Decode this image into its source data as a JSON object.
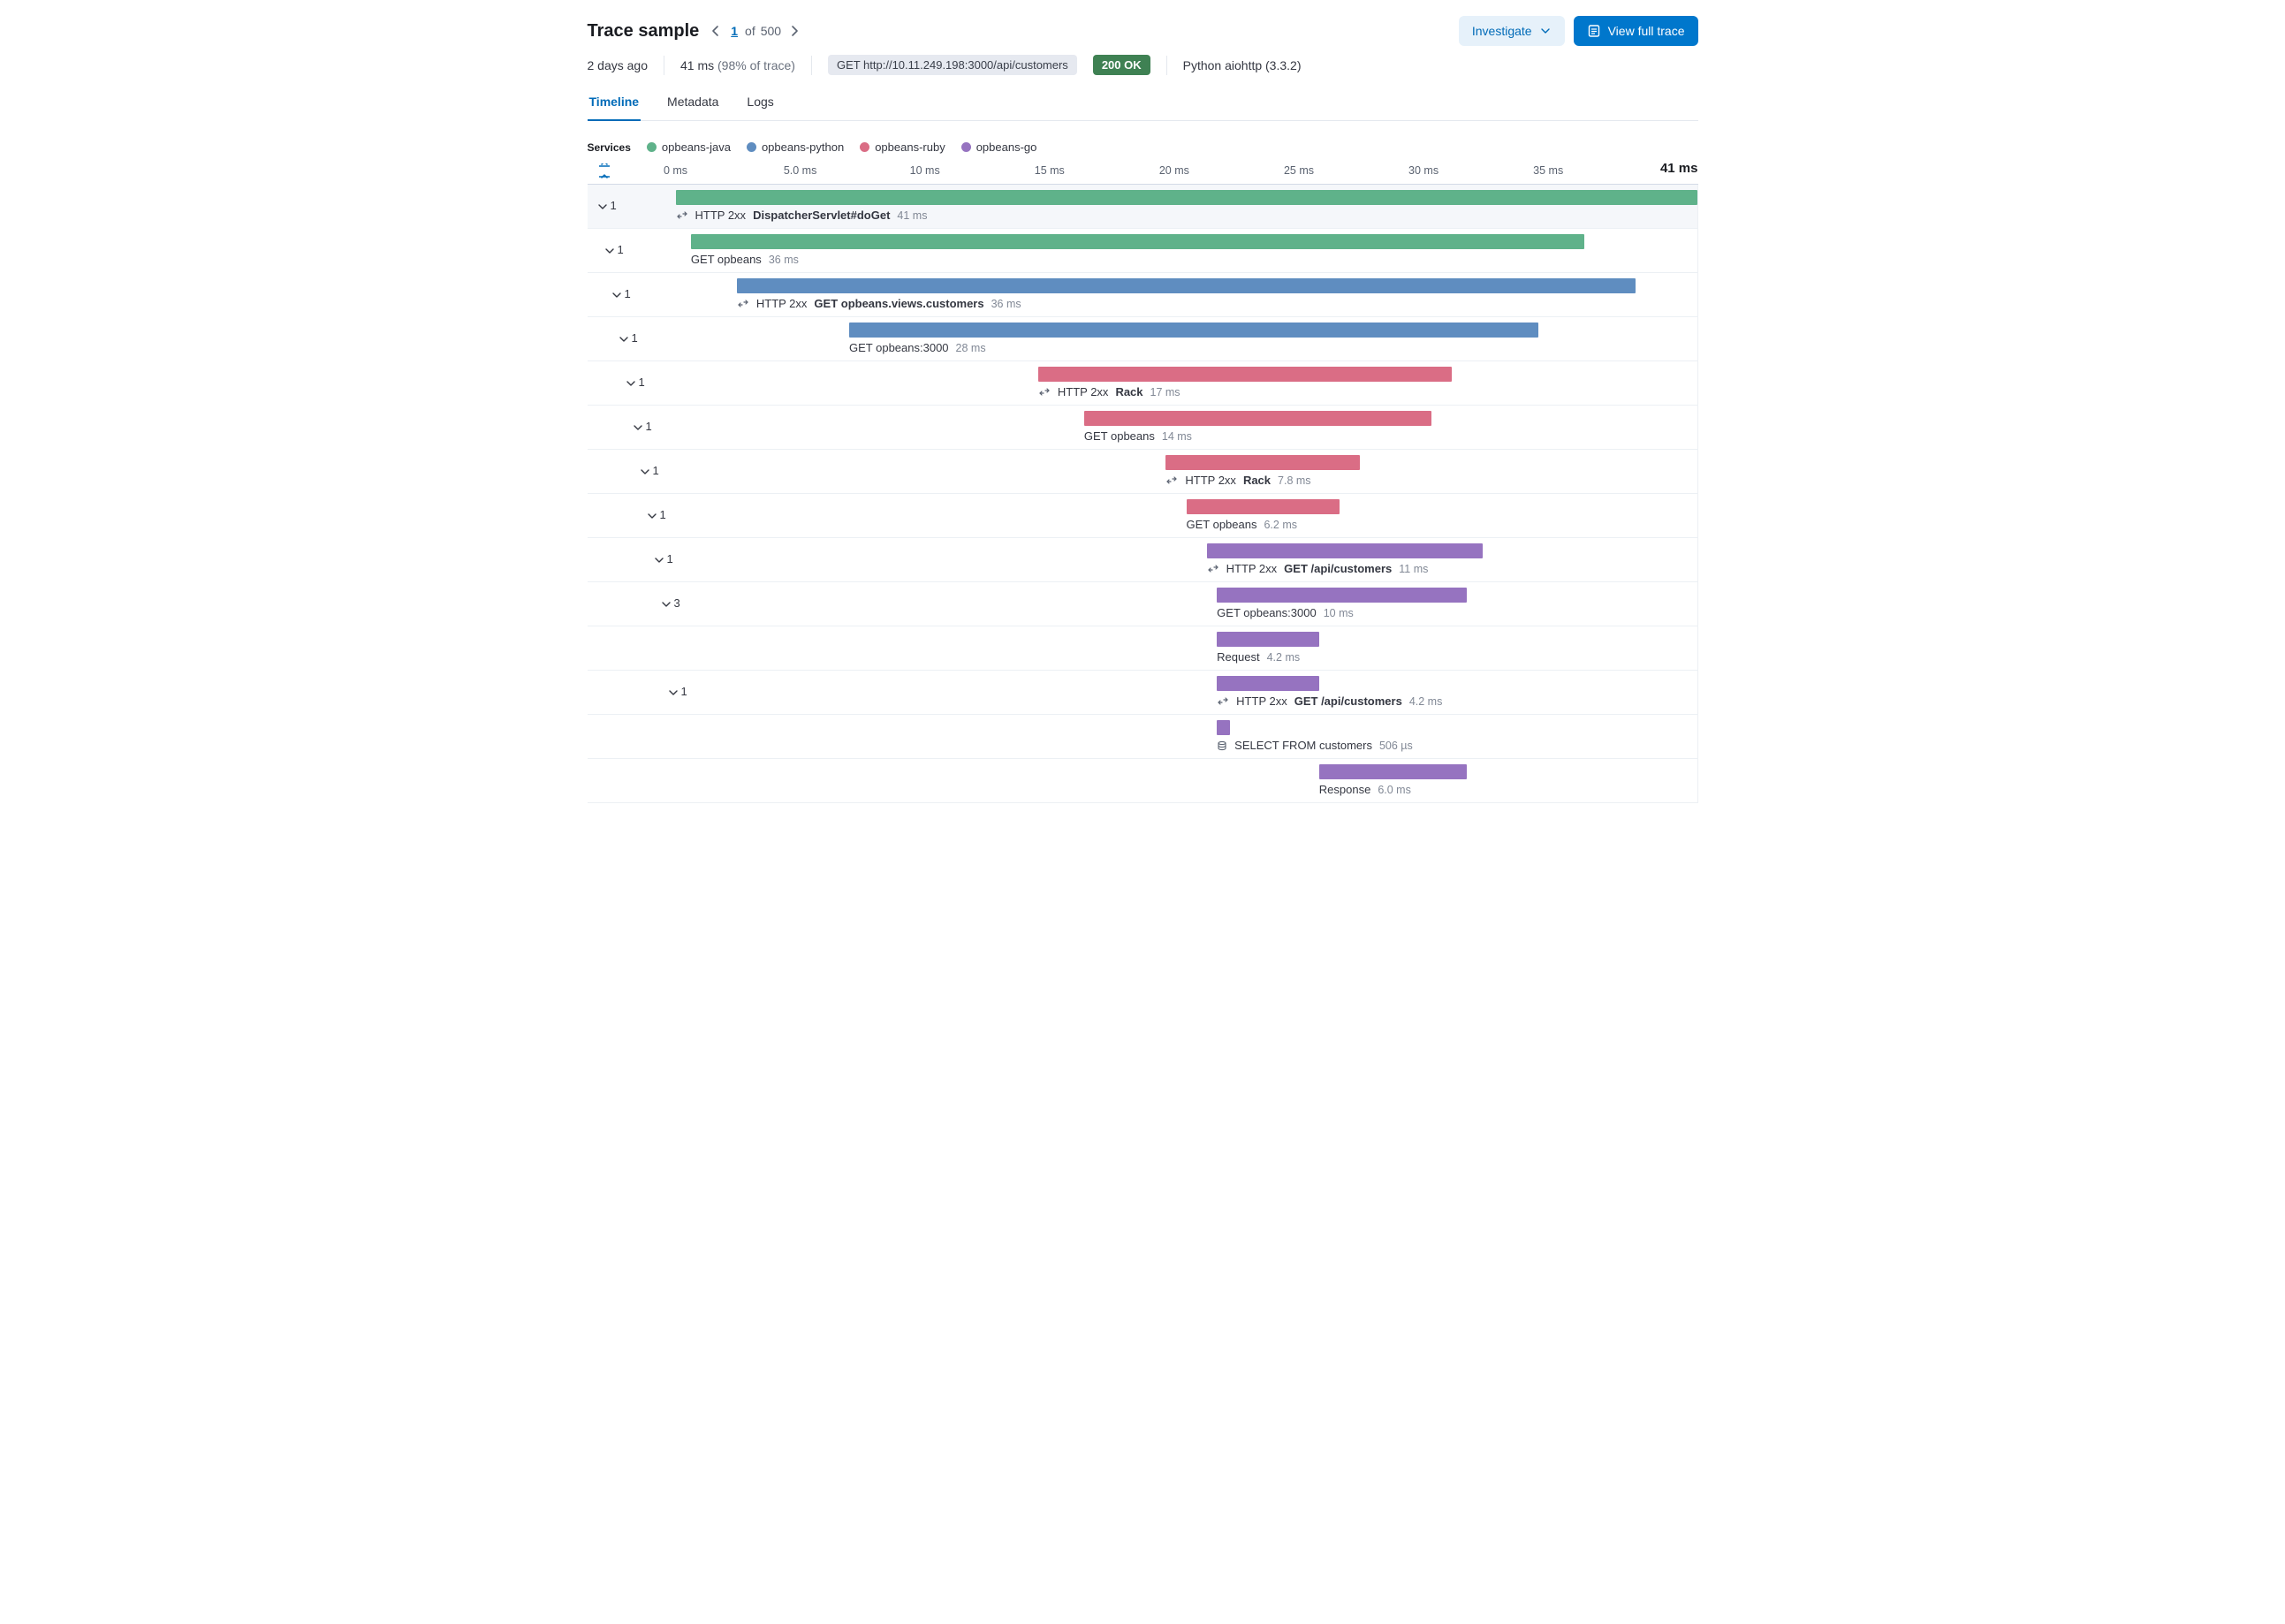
{
  "header": {
    "title": "Trace sample",
    "pager": {
      "current": "1",
      "of_word": "of",
      "total": "500"
    },
    "investigate_label": "Investigate",
    "view_full_label": "View full trace"
  },
  "meta": {
    "age": "2 days ago",
    "duration": "41 ms",
    "pct": "(98% of trace)",
    "method_url": "GET http://10.11.249.198:3000/api/customers",
    "status": "200 OK",
    "agent": "Python aiohttp (3.3.2)"
  },
  "tabs": {
    "timeline": "Timeline",
    "metadata": "Metadata",
    "logs": "Logs"
  },
  "legend": {
    "label": "Services",
    "items": [
      {
        "name": "opbeans-java",
        "color": "#5fb28a"
      },
      {
        "name": "opbeans-python",
        "color": "#5f8dc0"
      },
      {
        "name": "opbeans-ruby",
        "color": "#da6d85"
      },
      {
        "name": "opbeans-go",
        "color": "#9673c0"
      }
    ]
  },
  "ruler": {
    "ticks": [
      "0 ms",
      "5.0 ms",
      "10 ms",
      "15 ms",
      "20 ms",
      "25 ms",
      "30 ms",
      "35 ms"
    ],
    "total": "41 ms"
  },
  "spans": [
    {
      "depth": 0,
      "toggle_count": "1",
      "selected": true,
      "bar_start_pct": 0.0,
      "bar_width_pct": 100.0,
      "color": "c-java",
      "has_http": true,
      "http": "HTTP 2xx",
      "name": "DispatcherServlet#doGet",
      "name_bold": true,
      "dur": "41 ms"
    },
    {
      "depth": 1,
      "toggle_count": "1",
      "selected": false,
      "bar_start_pct": 1.5,
      "bar_width_pct": 87.5,
      "color": "c-java",
      "has_http": false,
      "http": "",
      "name": "GET opbeans",
      "name_bold": false,
      "dur": "36 ms"
    },
    {
      "depth": 2,
      "toggle_count": "1",
      "selected": false,
      "bar_start_pct": 6.0,
      "bar_width_pct": 88.0,
      "color": "c-python",
      "has_http": true,
      "http": "HTTP 2xx",
      "name": "GET opbeans.views.customers",
      "name_bold": true,
      "dur": "36 ms"
    },
    {
      "depth": 3,
      "toggle_count": "1",
      "selected": false,
      "bar_start_pct": 17.0,
      "bar_width_pct": 67.5,
      "color": "c-python",
      "has_http": false,
      "http": "",
      "name": "GET opbeans:3000",
      "name_bold": false,
      "dur": "28 ms"
    },
    {
      "depth": 4,
      "toggle_count": "1",
      "selected": false,
      "bar_start_pct": 35.5,
      "bar_width_pct": 40.5,
      "color": "c-ruby",
      "has_http": true,
      "http": "HTTP 2xx",
      "name": "Rack",
      "name_bold": true,
      "dur": "17 ms"
    },
    {
      "depth": 5,
      "toggle_count": "1",
      "selected": false,
      "bar_start_pct": 40.0,
      "bar_width_pct": 34.0,
      "color": "c-ruby",
      "has_http": false,
      "http": "",
      "name": "GET opbeans",
      "name_bold": false,
      "dur": "14 ms"
    },
    {
      "depth": 6,
      "toggle_count": "1",
      "selected": false,
      "bar_start_pct": 48.0,
      "bar_width_pct": 19.0,
      "color": "c-ruby",
      "has_http": true,
      "http": "HTTP 2xx",
      "name": "Rack",
      "name_bold": true,
      "dur": "7.8 ms"
    },
    {
      "depth": 7,
      "toggle_count": "1",
      "selected": false,
      "bar_start_pct": 50.0,
      "bar_width_pct": 15.0,
      "color": "c-ruby",
      "has_http": false,
      "http": "",
      "name": "GET opbeans",
      "name_bold": false,
      "dur": "6.2 ms"
    },
    {
      "depth": 8,
      "toggle_count": "1",
      "selected": false,
      "bar_start_pct": 52.0,
      "bar_width_pct": 27.0,
      "color": "c-go",
      "has_http": true,
      "http": "HTTP 2xx",
      "name": "GET /api/customers",
      "name_bold": true,
      "dur": "11 ms"
    },
    {
      "depth": 9,
      "toggle_count": "3",
      "selected": false,
      "bar_start_pct": 53.0,
      "bar_width_pct": 24.5,
      "color": "c-go",
      "has_http": false,
      "http": "",
      "name": "GET opbeans:3000",
      "name_bold": false,
      "dur": "10 ms"
    },
    {
      "depth": 10,
      "toggle_count": "",
      "selected": false,
      "bar_start_pct": 53.0,
      "bar_width_pct": 10.0,
      "color": "c-go",
      "has_http": false,
      "http": "",
      "name": "Request",
      "name_bold": false,
      "dur": "4.2 ms"
    },
    {
      "depth": 10,
      "toggle_count": "1",
      "selected": false,
      "bar_start_pct": 53.0,
      "bar_width_pct": 10.0,
      "color": "c-go",
      "has_http": true,
      "http": "HTTP 2xx",
      "name": "GET /api/customers",
      "name_bold": true,
      "dur": "4.2 ms"
    },
    {
      "depth": 11,
      "toggle_count": "",
      "selected": false,
      "bar_start_pct": 53.0,
      "bar_width_pct": 1.3,
      "color": "c-go",
      "has_db": true,
      "http": "",
      "name": "SELECT FROM customers",
      "name_bold": false,
      "dur": "506 µs"
    },
    {
      "depth": 11,
      "toggle_count": "",
      "selected": false,
      "bar_start_pct": 63.0,
      "bar_width_pct": 14.5,
      "color": "c-go",
      "has_http": false,
      "http": "",
      "name": "Response",
      "name_bold": false,
      "dur": "6.0 ms"
    }
  ]
}
